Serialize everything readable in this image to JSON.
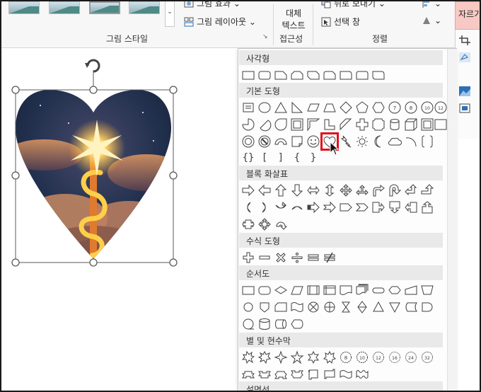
{
  "ribbon": {
    "picture_effects_label": "그림 효과",
    "picture_layout_label": "그림 레이아웃",
    "picture_styles_group_label": "그림 스타일",
    "alt_text_label_line1": "대체",
    "alt_text_label_line2": "텍스트",
    "accessibility_group_label": "접근성",
    "send_backward_label": "뒤로 보내기",
    "selection_pane_label": "선택 창",
    "arrange_group_label": "정렬",
    "crop_label": "자르기",
    "dropdown_glyph": "⌄",
    "dialog_launcher_glyph": "↘",
    "accent_color": "#f8c9c4"
  },
  "shapes_panel": {
    "categories": [
      {
        "label": "사각형"
      },
      {
        "label": "기본 도형"
      },
      {
        "label": "블록 화살표"
      },
      {
        "label": "수식 도형"
      },
      {
        "label": "순서도"
      },
      {
        "label": "별 및 현수막"
      },
      {
        "label": "설명선"
      }
    ],
    "octagon_labels": [
      "7",
      "8",
      "10",
      "12"
    ],
    "star_labels": [
      "8",
      "10",
      "12",
      "16",
      "24",
      "32"
    ],
    "brace_glyphs": [
      "{}",
      "[",
      "]",
      "{",
      "}"
    ],
    "selected_shape": "heart",
    "selected_color": "#e0111b"
  },
  "canvas": {
    "selection_color": "#595959",
    "heart_colors": [
      "#1a2c4a",
      "#e07a2e",
      "#ffcf4a"
    ]
  }
}
